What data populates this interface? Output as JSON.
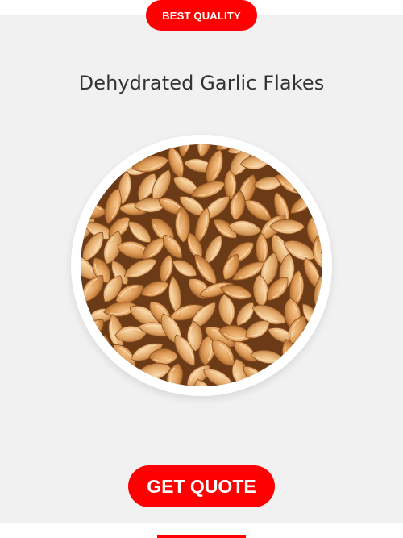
{
  "badge": {
    "label": "BEST QUALITY"
  },
  "product": {
    "title": "Dehydrated Garlic Flakes",
    "image_subject": "dried garlic cloves"
  },
  "cta": {
    "label": "GET QUOTE"
  },
  "colors": {
    "accent": "#ff0000",
    "card_background": "#f1f1f1",
    "title_text": "#333333",
    "button_text": "#ffffff"
  }
}
